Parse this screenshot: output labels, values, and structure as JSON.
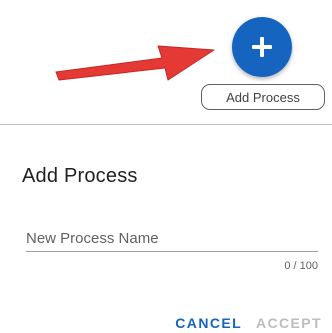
{
  "toolbar": {
    "fab_icon": "plus-icon",
    "tooltip": "Add Process",
    "arrow_icon": "red-arrow-icon"
  },
  "dialog": {
    "title": "Add Process",
    "input": {
      "placeholder": "New Process Name",
      "value": ""
    },
    "counter": "0 / 100",
    "cancel_label": "CANCEL",
    "accept_label": "ACCEPT"
  },
  "colors": {
    "accent": "#1565c0",
    "arrow": "#e53935",
    "disabled": "#bdbdbd"
  }
}
